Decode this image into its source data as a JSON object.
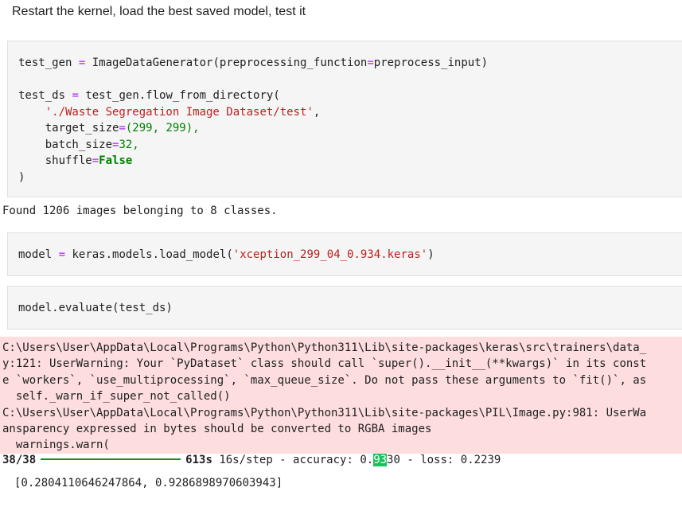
{
  "markdown": {
    "heading": "Restart the kernel, load the best saved model, test it"
  },
  "cell1": {
    "l1_var": "test_gen",
    "l1_rhs": "ImageDataGenerator(preprocessing_function",
    "l1_arg": "preprocess_input)",
    "l3_var": "test_ds",
    "l3_rhs": "test_gen.flow_from_directory(",
    "l4_str": "'./Waste Segregation Image Dataset/test'",
    "l5_key": "target_size",
    "l5_val": "(299, 299),",
    "l6_key": "batch_size",
    "l6_val": "32,",
    "l7_key": "shuffle",
    "l7_val": "False",
    "l8": ")"
  },
  "cell1_output": "Found 1206 images belonging to 8 classes.",
  "cell2": {
    "var": "model",
    "call": "keras.models.load_model(",
    "arg": "'xception_299_04_0.934.keras'",
    "close": ")"
  },
  "cell3": {
    "code": "model.evaluate(test_ds)"
  },
  "stderr_lines": {
    "l1": "C:\\Users\\User\\AppData\\Local\\Programs\\Python\\Python311\\Lib\\site-packages\\keras\\src\\trainers\\data_",
    "l2": "y:121: UserWarning: Your `PyDataset` class should call `super().__init__(**kwargs)` in its const",
    "l3": "e `workers`, `use_multiprocessing`, `max_queue_size`. Do not pass these arguments to `fit()`, as",
    "l4": "  self._warn_if_super_not_called()",
    "l5": "C:\\Users\\User\\AppData\\Local\\Programs\\Python\\Python311\\Lib\\site-packages\\PIL\\Image.py:981: UserWa",
    "l6": "ansparency expressed in bytes should be converted to RGBA images",
    "l7": "  warnings.warn("
  },
  "progress": {
    "steps": "38/38",
    "time": "613s",
    "rest_a": "16s/step - accuracy: 0.",
    "highlight": "93",
    "rest_b": "30 - loss: 0.2239"
  },
  "result": "[0.2804110646247864, 0.9286898970603943]"
}
